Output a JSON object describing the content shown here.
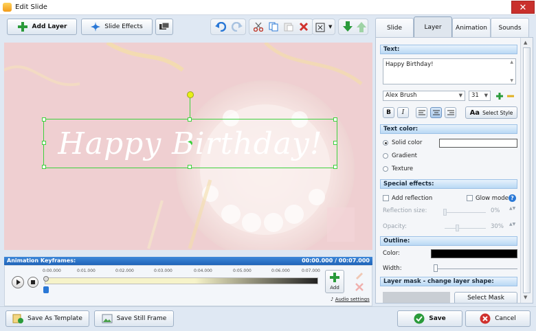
{
  "window": {
    "title": "Edit Slide",
    "close_glyph": "✕"
  },
  "toolbar": {
    "add_layer": "Add Layer",
    "slide_effects": "Slide Effects"
  },
  "canvas": {
    "text": "Happy Birthday!"
  },
  "keyframes": {
    "header": "Animation Keyframes:",
    "time": "00:00.000 / 00:07.000",
    "ticks": [
      "0:00.000",
      "0:01.000",
      "0:02.000",
      "0:03.000",
      "0:04.000",
      "0:05.000",
      "0:06.000",
      "0:07.000"
    ],
    "add_label": "Add",
    "audio_settings": "Audio settings"
  },
  "tabs": [
    "Slide",
    "Layer",
    "Animation",
    "Sounds"
  ],
  "active_tab": "Layer",
  "layer_panel": {
    "text_header": "Text:",
    "text_value": "Happy Birthday!",
    "font": "Alex Brush",
    "size": "31",
    "bold": "B",
    "italic": "I",
    "select_style": "Select Style",
    "select_style_glyph": "Aa",
    "text_color_header": "Text color:",
    "solid_color": "Solid color",
    "gradient": "Gradient",
    "texture": "Texture",
    "special_header": "Special effects:",
    "add_reflection": "Add reflection",
    "glow_mode": "Glow mode",
    "reflection_size": "Reflection size:",
    "reflection_value": "0%",
    "opacity": "Opacity:",
    "opacity_value": "30%",
    "outline_header": "Outline:",
    "color_label": "Color:",
    "width_label": "Width:",
    "mask_header": "Layer mask - change layer shape:",
    "select_mask": "Select Mask"
  },
  "bottom": {
    "save_template": "Save As Template",
    "save_still": "Save Still Frame",
    "save": "Save",
    "cancel": "Cancel"
  },
  "colors": {
    "accent": "#1f63b8",
    "save_green": "#2a9a3a",
    "cancel_red": "#d0312d"
  }
}
